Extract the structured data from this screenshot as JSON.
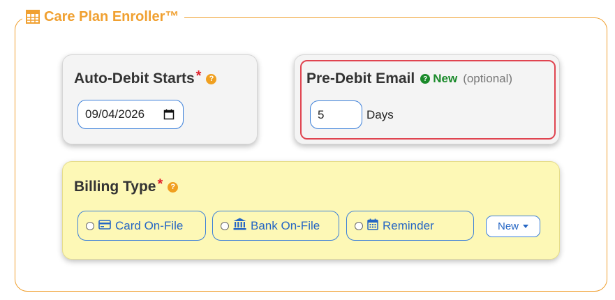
{
  "panel": {
    "title": "Care Plan Enroller™",
    "icon": "table-grid-icon",
    "accent_color": "#f0a030"
  },
  "auto_debit": {
    "title": "Auto-Debit Starts",
    "required_mark": "*",
    "help": "?",
    "date_value": "09/04/2026"
  },
  "pre_debit": {
    "title": "Pre-Debit Email",
    "new_badge": "New",
    "help": "?",
    "optional_text": "(optional)",
    "days_value": "5",
    "days_label": "Days",
    "highlight_color": "#e04450"
  },
  "billing": {
    "title": "Billing Type",
    "required_mark": "*",
    "help": "?",
    "background_color": "#fdf8b6",
    "options": [
      {
        "label": "Card On-File",
        "icon": "credit-card-icon"
      },
      {
        "label": "Bank On-File",
        "icon": "bank-icon"
      },
      {
        "label": "Reminder",
        "icon": "calendar-icon"
      }
    ],
    "new_button": "New"
  }
}
